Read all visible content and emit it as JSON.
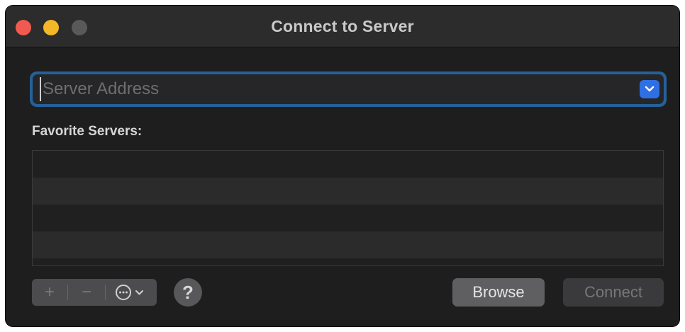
{
  "window": {
    "title": "Connect to Server"
  },
  "address": {
    "placeholder": "Server Address",
    "value": ""
  },
  "favorites": {
    "label": "Favorite Servers:",
    "items": []
  },
  "toolbar": {
    "add_label": "+",
    "remove_label": "−",
    "more_icon": "ellipsis-circle-icon",
    "help_label": "?"
  },
  "buttons": {
    "browse_label": "Browse",
    "connect_label": "Connect"
  },
  "colors": {
    "accent": "#2f6fe4",
    "focus_ring": "#24619a",
    "close": "#f05a50",
    "minimize": "#f4b728",
    "maximize": "#59595a"
  }
}
